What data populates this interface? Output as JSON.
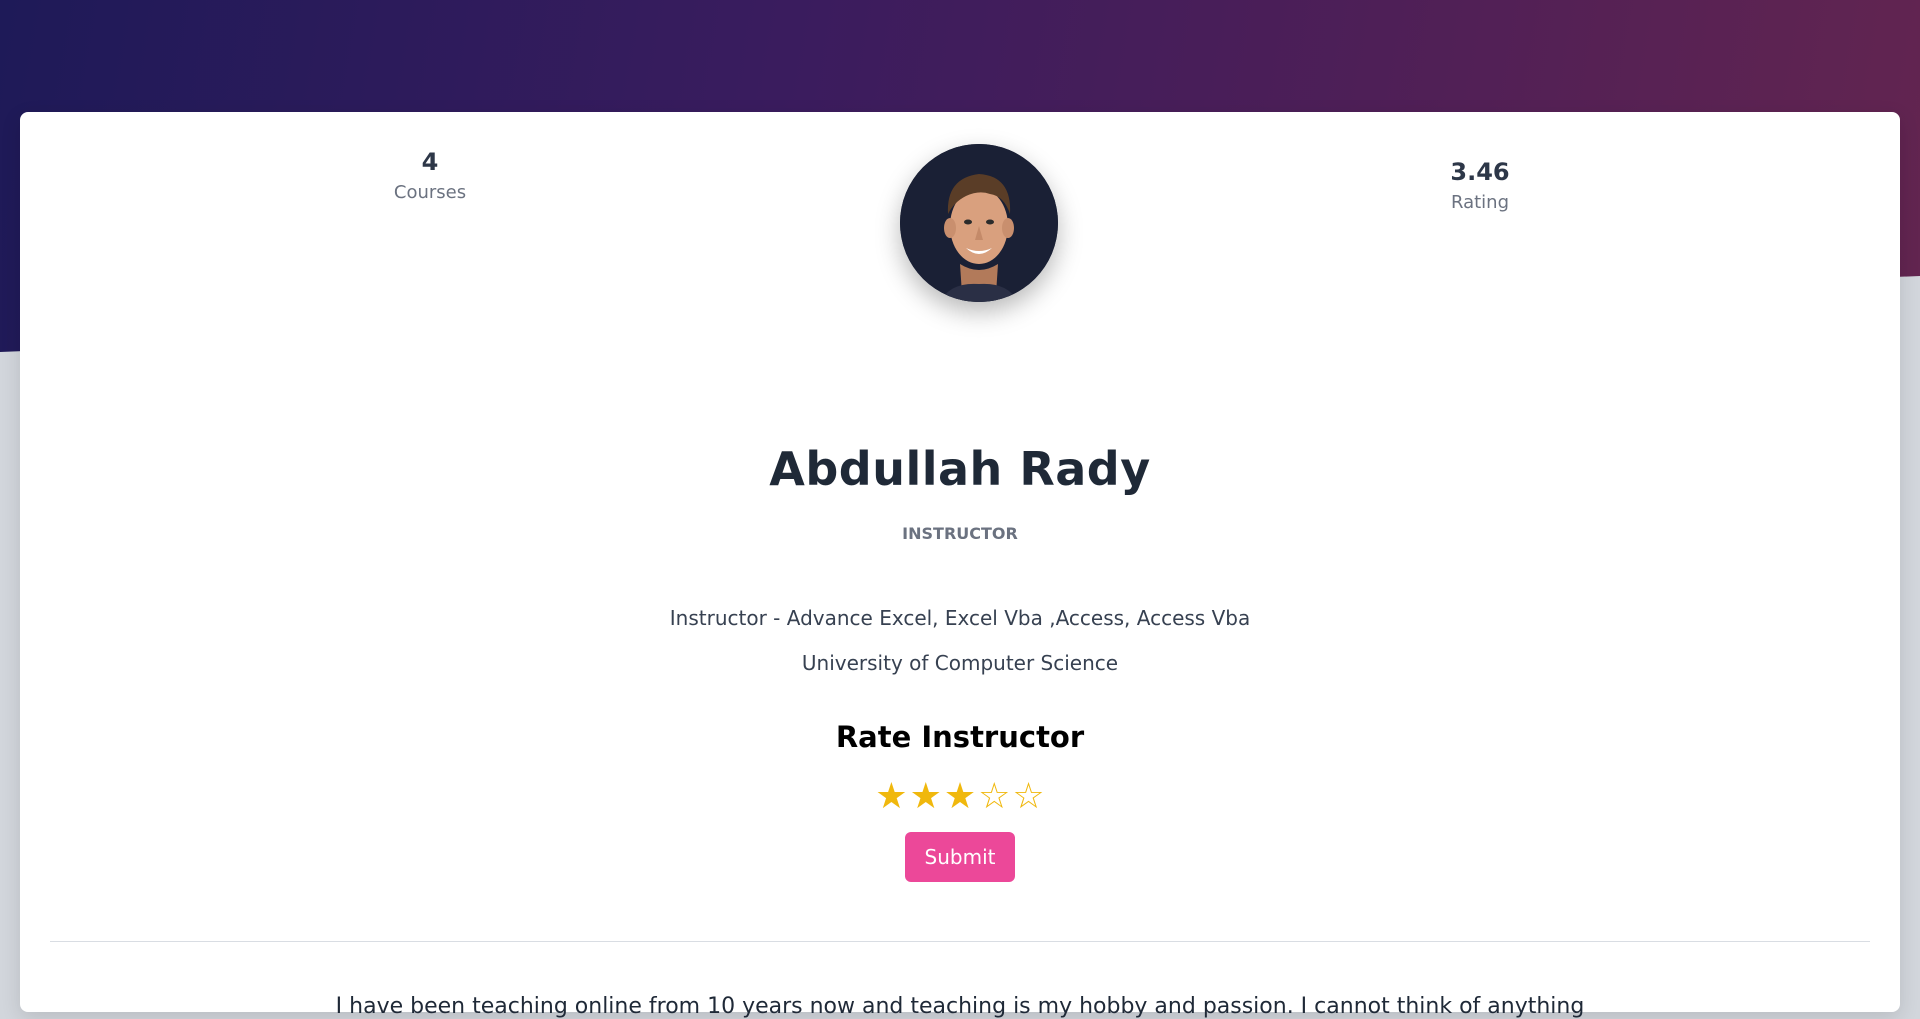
{
  "profile": {
    "name": "Abdullah Rady",
    "role": "INSTRUCTOR",
    "bio_line_1": "Instructor - Advance Excel, Excel Vba ,Access, Access Vba",
    "bio_line_2": "University of Computer Science",
    "about": "I have been teaching online from 10 years now and teaching is my hobby and passion. I cannot think of anything"
  },
  "stats": {
    "courses_value": "4",
    "courses_label": "Courses",
    "rating_value": "3.46",
    "rating_label": "Rating"
  },
  "rating_form": {
    "title": "Rate Instructor",
    "selected_stars": 3,
    "max_stars": 5,
    "submit_label": "Submit"
  },
  "icons": {
    "star_filled": "★",
    "star_empty": "☆"
  },
  "colors": {
    "accent": "#ec4899",
    "star": "#f0b80d",
    "hero_start": "#1e1a58",
    "hero_end": "#632550"
  }
}
